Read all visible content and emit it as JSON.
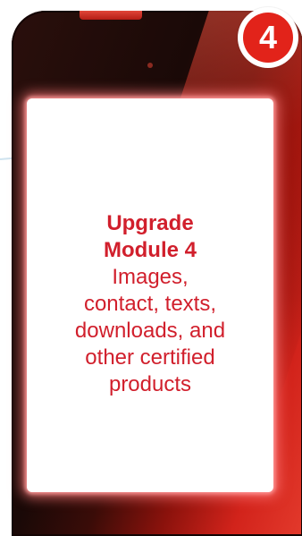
{
  "badge": {
    "number": "4"
  },
  "screen": {
    "title_line1": "Upgrade",
    "title_line2": "Module 4",
    "description_lines": [
      "Images,",
      "contact, texts,",
      "downloads, and",
      "other certified",
      "products"
    ]
  },
  "colors": {
    "accent": "#d11f2c",
    "phone_body": "#1a0907",
    "badge": "#e2231a"
  }
}
